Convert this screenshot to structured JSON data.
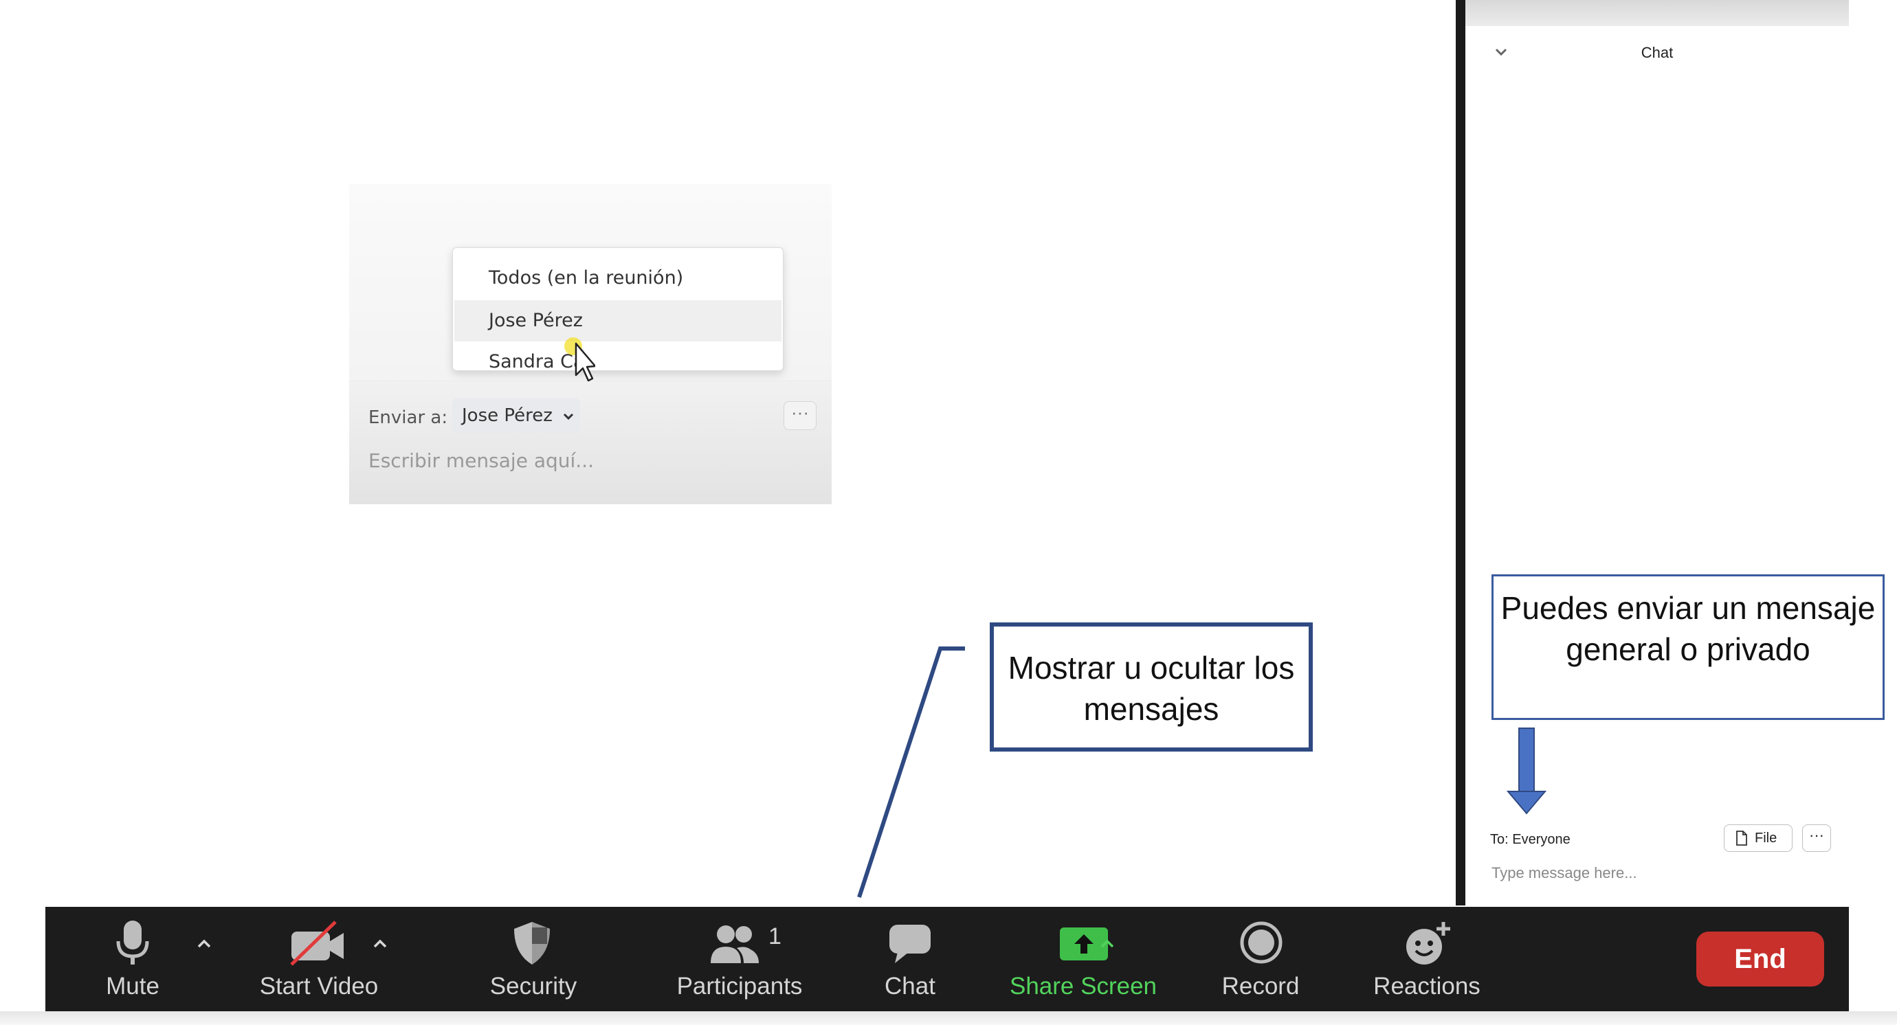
{
  "inset": {
    "dropdown_items": [
      "Todos (en la reunión)",
      "Jose Pérez",
      "Sandra Ca"
    ],
    "dropdown_selected": "Jose Pérez",
    "send_to_label": "Enviar a:",
    "send_to_value": "Jose Pérez",
    "more_label": "···",
    "placeholder": "Escribir mensaje aquí..."
  },
  "chat_panel": {
    "title": "Chat",
    "to_label": "To: Everyone",
    "file_label": "File",
    "more_label": "···",
    "input_placeholder": "Type message here..."
  },
  "annotations": {
    "right_note": "Puedes enviar un mensaje general o privado",
    "chat_note": "Mostrar u ocultar los mensajes"
  },
  "toolbar": {
    "mute": "Mute",
    "start_video": "Start Video",
    "security": "Security",
    "participants": "Participants",
    "participants_count": "1",
    "chat": "Chat",
    "share_screen": "Share Screen",
    "record": "Record",
    "reactions": "Reactions",
    "end": "End"
  },
  "colors": {
    "toolbar_bg": "#1c1c1c",
    "share_green": "#52d45c",
    "end_red": "#c8302c",
    "annotation_blue": "#2f4a82",
    "arrow_blue": "#4a72c4"
  },
  "icons": [
    "microphone-icon",
    "video-off-icon",
    "shield-icon",
    "people-icon",
    "chat-bubble-icon",
    "share-screen-icon",
    "record-icon",
    "reaction-add-icon",
    "chevron-up-icon",
    "chevron-down-icon",
    "file-icon",
    "cursor-icon"
  ]
}
